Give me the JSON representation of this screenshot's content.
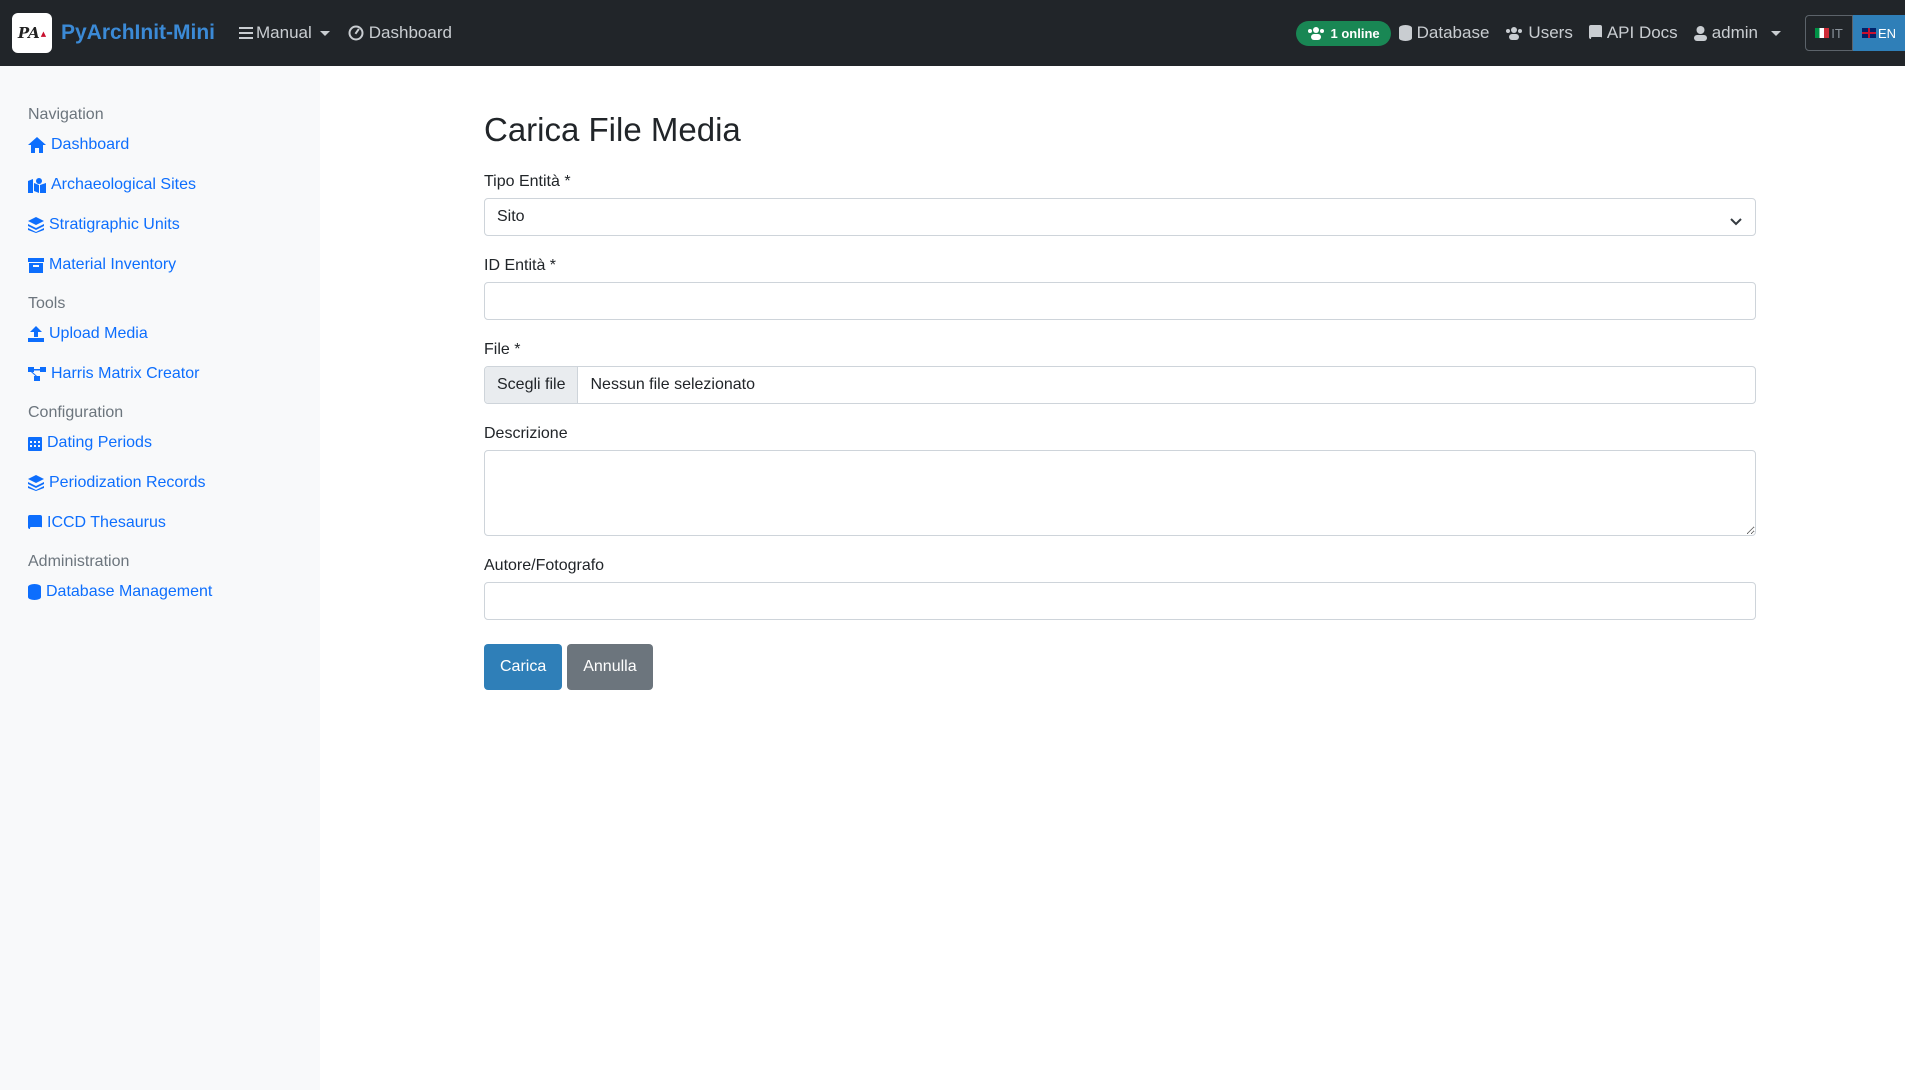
{
  "brand": {
    "name": "PyArchInit-Mini",
    "logo_text": "PA"
  },
  "navbar": {
    "manual": "Manual",
    "dashboard": "Dashboard",
    "online_badge": "1 online",
    "database": "Database",
    "users": "Users",
    "api_docs": "API Docs",
    "user": "admin",
    "lang_it": "IT",
    "lang_en": "EN"
  },
  "sidebar": {
    "sections": [
      {
        "heading": "Navigation",
        "items": [
          "Dashboard",
          "Archaeological Sites",
          "Stratigraphic Units",
          "Material Inventory"
        ]
      },
      {
        "heading": "Tools",
        "items": [
          "Upload Media",
          "Harris Matrix Creator"
        ]
      },
      {
        "heading": "Configuration",
        "items": [
          "Dating Periods",
          "Periodization Records",
          "ICCD Thesaurus"
        ]
      },
      {
        "heading": "Administration",
        "items": [
          "Database Management"
        ]
      }
    ]
  },
  "form": {
    "title": "Carica File Media",
    "entity_type_label": "Tipo Entità *",
    "entity_type_value": "Sito",
    "entity_id_label": "ID Entità *",
    "entity_id_value": "",
    "file_label": "File *",
    "file_button": "Scegli file",
    "file_status": "Nessun file selezionato",
    "description_label": "Descrizione",
    "description_value": "",
    "author_label": "Autore/Fotografo",
    "author_value": "",
    "submit": "Carica",
    "cancel": "Annulla"
  },
  "colors": {
    "navbar_bg": "#212529",
    "brand": "#3b8ad6",
    "link": "#0d6efd",
    "online_badge": "#198754",
    "primary_button": "#2f7fb8",
    "secondary_button": "#6c757d",
    "sidebar_bg": "#f8f9fa"
  }
}
